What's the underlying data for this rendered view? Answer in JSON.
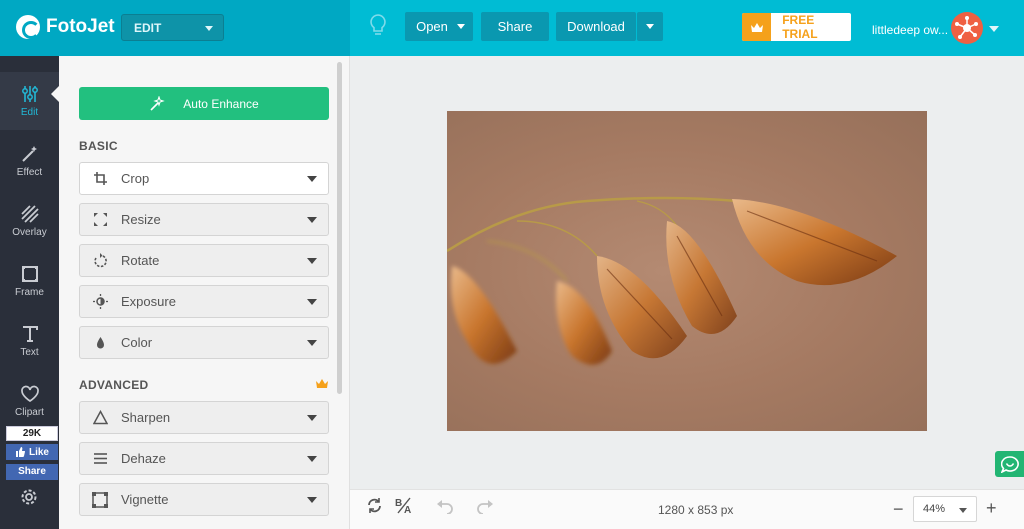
{
  "app": {
    "name": "FotoJet",
    "mode_select": "EDIT"
  },
  "toolbar": {
    "open_label": "Open",
    "share_label": "Share",
    "download_label": "Download",
    "free_trial_label": "FREE TRIAL",
    "user_name": "littledeep ow..."
  },
  "rail": {
    "items": [
      {
        "label": "Edit",
        "icon": "sliders-icon",
        "active": true
      },
      {
        "label": "Effect",
        "icon": "magic-wand-icon"
      },
      {
        "label": "Overlay",
        "icon": "overlay-stripes-icon"
      },
      {
        "label": "Frame",
        "icon": "frame-icon"
      },
      {
        "label": "Text",
        "icon": "text-icon"
      },
      {
        "label": "Clipart",
        "icon": "heart-icon"
      }
    ],
    "facebook": {
      "count": "29K",
      "like_label": "Like",
      "share_label": "Share"
    }
  },
  "panel": {
    "auto_enhance_label": "Auto Enhance",
    "basic_title": "BASIC",
    "basic_tools": [
      {
        "label": "Crop",
        "icon": "crop-icon"
      },
      {
        "label": "Resize",
        "icon": "resize-icon"
      },
      {
        "label": "Rotate",
        "icon": "rotate-icon"
      },
      {
        "label": "Exposure",
        "icon": "exposure-icon"
      },
      {
        "label": "Color",
        "icon": "color-drop-icon"
      }
    ],
    "advanced_title": "ADVANCED",
    "advanced_tools": [
      {
        "label": "Sharpen",
        "icon": "sharpen-triangle-icon"
      },
      {
        "label": "Dehaze",
        "icon": "dehaze-lines-icon"
      },
      {
        "label": "Vignette",
        "icon": "vignette-icon"
      }
    ]
  },
  "canvas": {
    "image_dimensions": "1280 x 853 px",
    "zoom": "44%"
  },
  "colors": {
    "brand": "#00bcd4",
    "accent_green": "#22c07f",
    "trial_orange": "#f5a11b",
    "rail_bg": "#2a2f3a"
  }
}
